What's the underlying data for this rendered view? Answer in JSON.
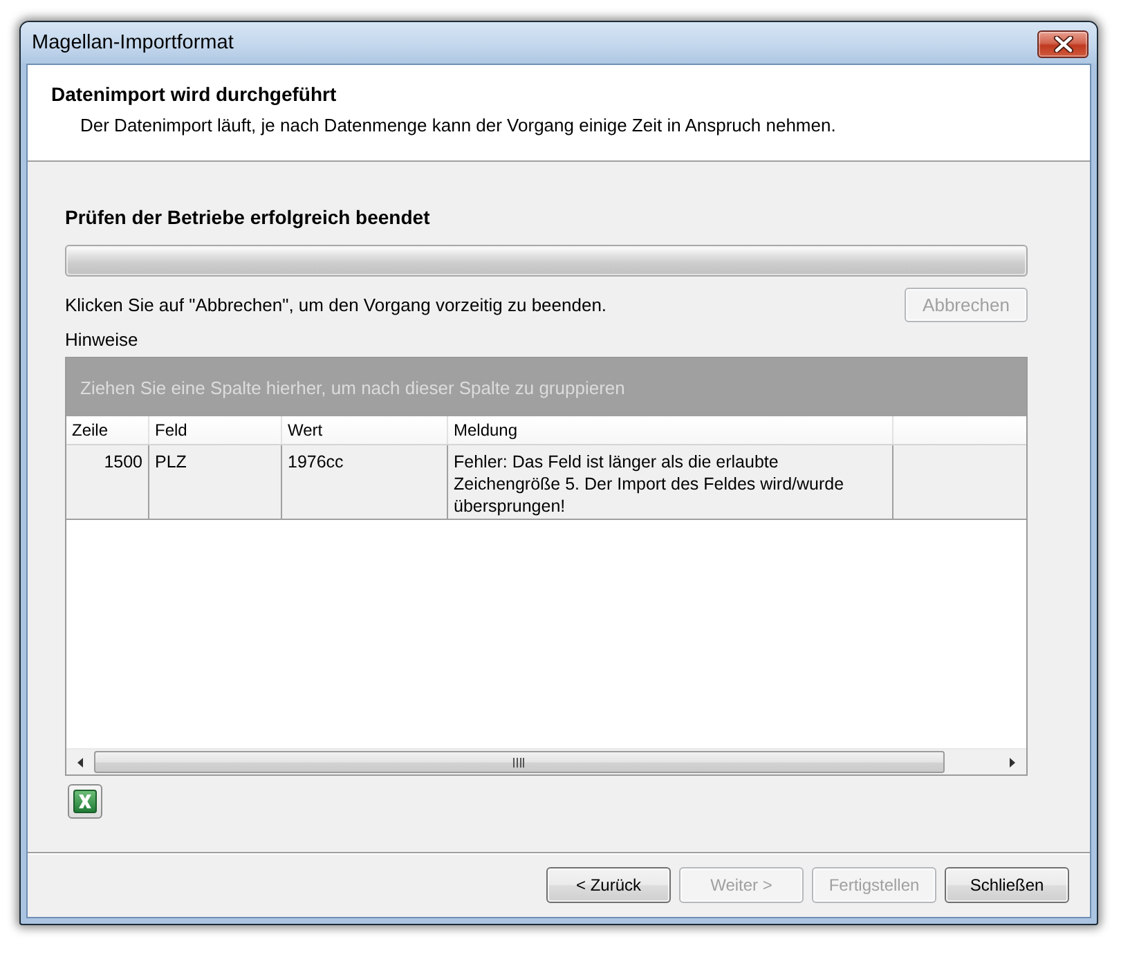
{
  "window": {
    "title": "Magellan-Importformat"
  },
  "header": {
    "title": "Datenimport wird durchgeführt",
    "subtitle": "Der Datenimport läuft, je nach Datenmenge kann der Vorgang einige Zeit in Anspruch nehmen."
  },
  "status": {
    "text": "Prüfen der Betriebe erfolgreich beendet"
  },
  "progress": {
    "level": 1
  },
  "cancel": {
    "hint": "Klicken Sie auf \"Abbrechen\", um den Vorgang vorzeitig zu beenden.",
    "button": {
      "label": "Abbrechen",
      "disabled": true
    }
  },
  "notes": {
    "label": "Hinweise",
    "group_panel": "Ziehen Sie eine Spalte hierher, um nach dieser Spalte zu gruppieren",
    "columns": [
      {
        "label": "Zeile"
      },
      {
        "label": "Feld"
      },
      {
        "label": "Wert"
      },
      {
        "label": "Meldung"
      }
    ],
    "rows": [
      {
        "cells": [
          "1500",
          "PLZ",
          "1976cc",
          "Fehler: Das Feld ist länger als die erlaubte\nZeichengröße 5. Der Import des Feldes wird/wurde\nübersprungen!"
        ]
      }
    ]
  },
  "footer_buttons": [
    {
      "label": "< Zurück",
      "disabled": false
    },
    {
      "label": "Weiter >",
      "disabled": true
    },
    {
      "label": "Fertigstellen",
      "disabled": true
    },
    {
      "label": "Schließen",
      "disabled": false
    }
  ]
}
